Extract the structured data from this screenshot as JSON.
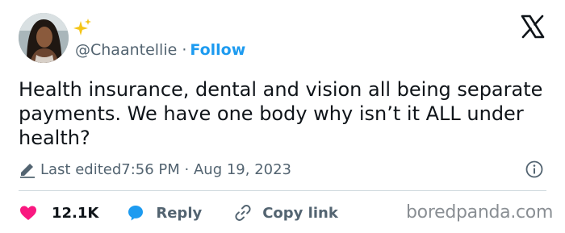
{
  "author": {
    "handle": "@Chaantellie",
    "separator": "·",
    "follow_label": "Follow",
    "badge_emoji": "sparkles-icon",
    "avatar_icon": "profile-photo"
  },
  "platform_icon": "x-logo-icon",
  "tweet": {
    "text": "Health insurance, dental and vision all being separate payments. We have one body why isn’t it ALL under health?"
  },
  "meta": {
    "edited_label": "Last edited",
    "timestamp": "7:56 PM · Aug 19, 2023",
    "edit_icon": "pencil-icon",
    "info_icon": "info-icon"
  },
  "actions": {
    "like_count": "12.1K",
    "reply_label": "Reply",
    "copy_label": "Copy link"
  },
  "watermark": "boredpanda.com",
  "colors": {
    "accent": "#1d9bf0",
    "heart": "#f91880",
    "muted": "#536471",
    "text": "#0f1419",
    "divider": "#cfd9de"
  }
}
